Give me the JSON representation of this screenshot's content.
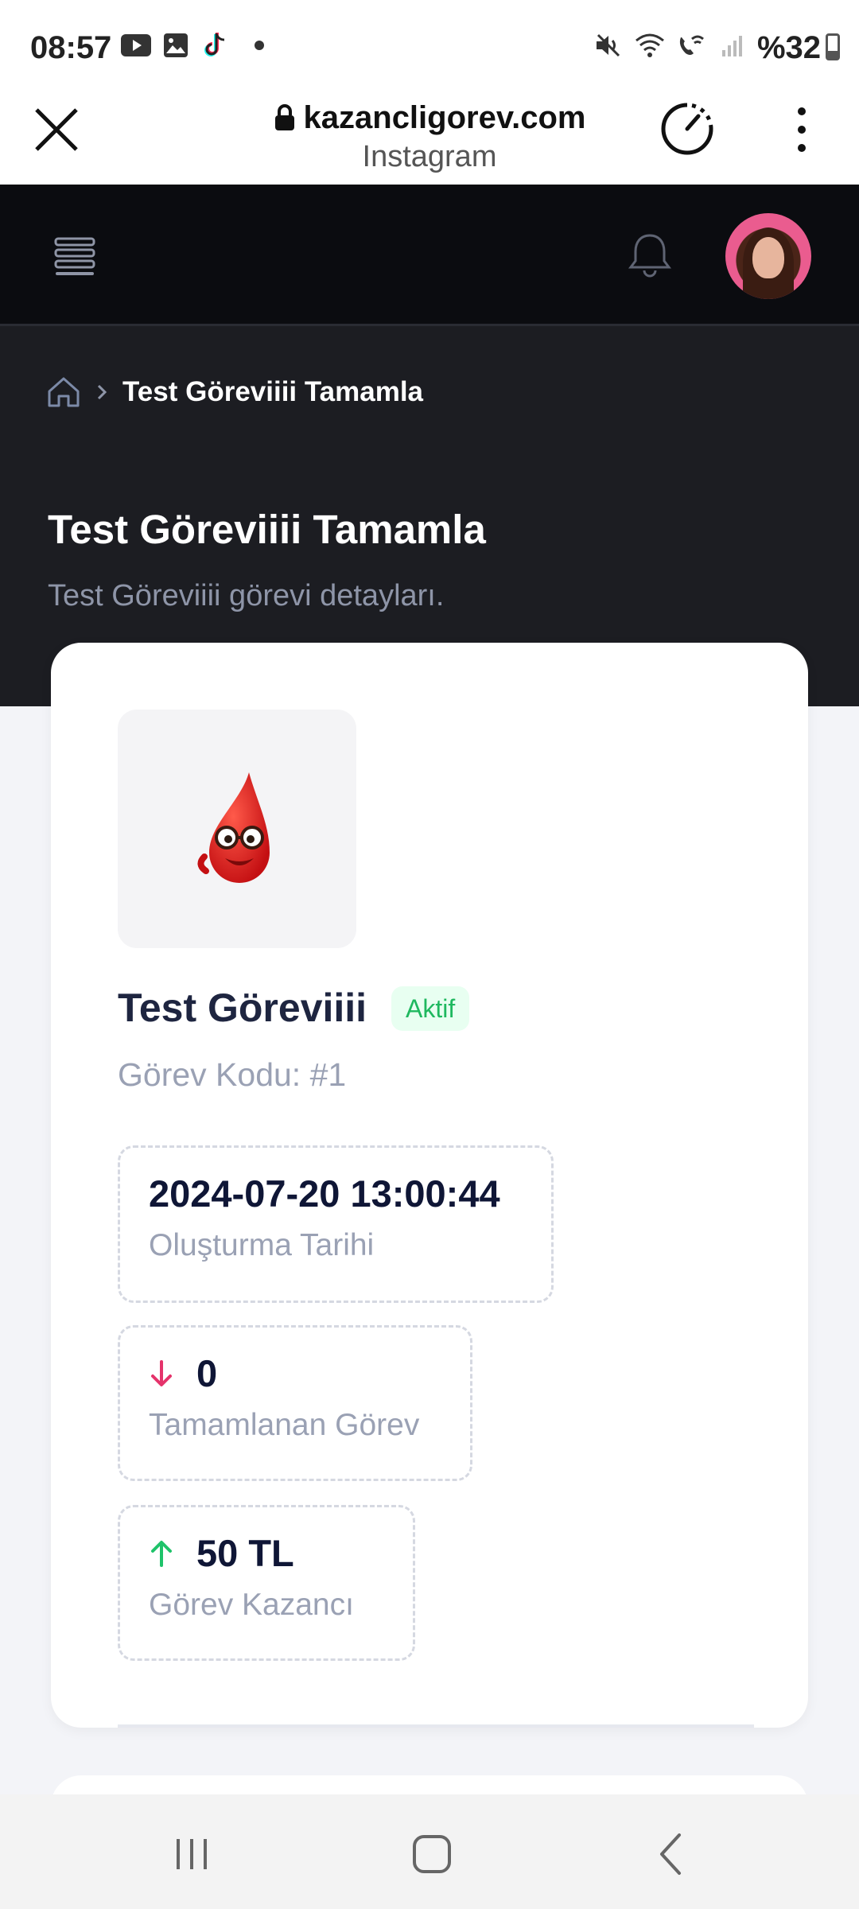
{
  "status_bar": {
    "time": "08:57",
    "battery": "%32",
    "left_icons": [
      "youtube-icon",
      "gallery-icon",
      "tiktok-icon",
      "dot-icon"
    ],
    "right_icons": [
      "mute-icon",
      "wifi-icon",
      "wifi-call-icon",
      "signal-icon",
      "battery-icon"
    ]
  },
  "browser": {
    "url": "kazancligorev.com",
    "source": "Instagram"
  },
  "breadcrumb": {
    "current": "Test Göreviiii Tamamla"
  },
  "page": {
    "title": "Test Göreviiii Tamamla",
    "subtitle": "Test Göreviiii görevi detayları."
  },
  "task": {
    "name": "Test Göreviiii",
    "status": "Aktif",
    "code": "Görev Kodu: #1",
    "created_at": "2024-07-20 13:00:44",
    "created_label": "Oluşturma Tarihi",
    "completed_count": "0",
    "completed_label": "Tamamlanan Görev",
    "earning": "50 TL",
    "earning_label": "Görev Kazancı"
  },
  "colors": {
    "header_bg": "#0b0c10",
    "hero_bg": "#1c1d22",
    "badge_green": "#1fb85f",
    "arrow_down": "#e5336b",
    "arrow_up": "#1fc36a"
  }
}
